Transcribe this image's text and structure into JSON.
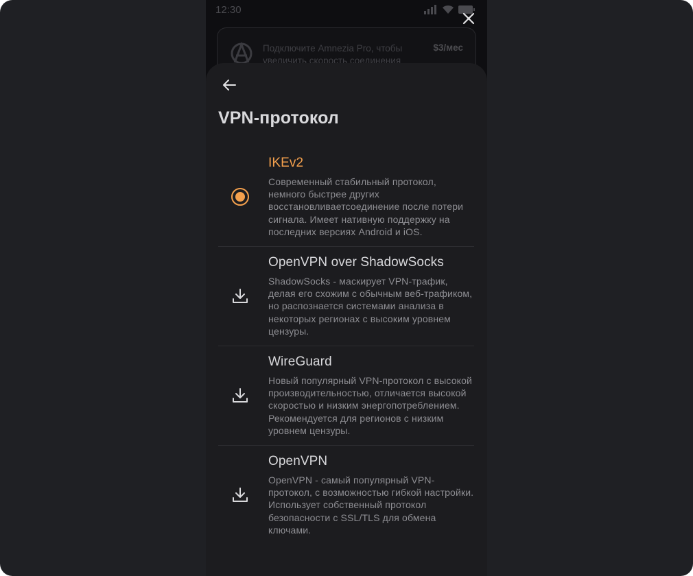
{
  "status_bar": {
    "time": "12:30"
  },
  "promo": {
    "text": "Подключите Amnezia Pro, чтобы увеличить скорость соединения",
    "price": "$3/мес",
    "icon": "anarchy-logo-icon"
  },
  "sheet": {
    "title": "VPN-протокол",
    "back_icon": "arrow-left-icon",
    "close_icon": "close-icon"
  },
  "protocols": [
    {
      "title": "IKEv2",
      "description": "Современный стабильный протокол, немного быстрее других восстановливаетсоединение после потери сигнала. Имеет нативную поддержку на последних версиях Android и iOS.",
      "selected": true,
      "icon": "radio-selected-icon"
    },
    {
      "title": "OpenVPN over ShadowSocks",
      "description": "ShadowSocks - маскирует VPN-трафик, делая его схожим с обычным веб-трафиком, но распознается системами анализа в некоторых регионах с высоким уровнем цензуры.",
      "selected": false,
      "icon": "download-icon"
    },
    {
      "title": "WireGuard",
      "description": "Новый популярный VPN-протокол с высокой производительностью, отличается высокой скоростью и низким энергопотреблением. Рекомендуется для регионов с низким уровнем цензуры.",
      "selected": false,
      "icon": "download-icon"
    },
    {
      "title": "OpenVPN",
      "description": "OpenVPN - самый популярный VPN-протокол, с возможностью гибкой настройки. Использует собственный протокол безопасности с SSL/TLS для обмена ключами.",
      "selected": false,
      "icon": "download-icon"
    }
  ],
  "colors": {
    "accent": "#f4a04d",
    "sheet_bg": "#1c1c1f",
    "text_primary": "#d9d9dc",
    "text_secondary": "#8e8e93"
  }
}
